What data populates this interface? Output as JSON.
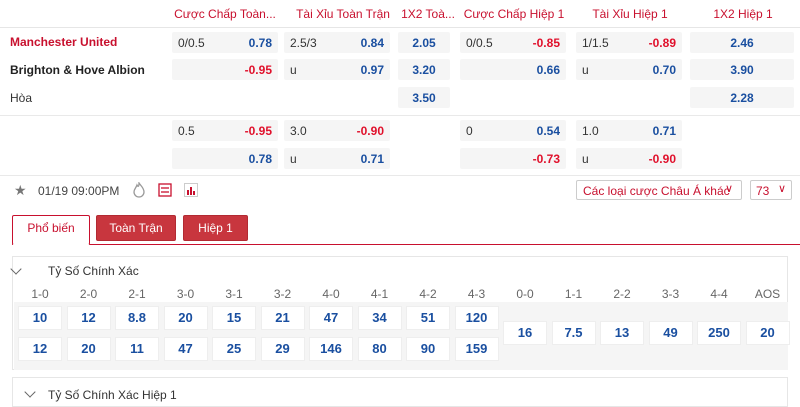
{
  "header": {
    "ah_ft": "Cược Chấp Toàn...",
    "ou_ft": "Tài Xỉu Toàn Trận",
    "x12_ft": "1X2 Toà...",
    "ah_h1": "Cược Chấp Hiệp 1",
    "ou_h1": "Tài Xỉu Hiệp 1",
    "x12_h1": "1X2 Hiệp 1"
  },
  "teams": {
    "home": "Manchester United",
    "away": "Brighton & Hove Albion",
    "draw": "Hòa"
  },
  "row1": {
    "ah_ft_line": "0/0.5",
    "ah_ft_home": "0.78",
    "ah_ft_away": "-0.95",
    "ou_ft_line": "2.5/3",
    "ou_ft_over": "0.84",
    "ou_ft_u": "u",
    "ou_ft_under": "0.97",
    "x12_home": "2.05",
    "x12_away": "3.20",
    "x12_draw": "3.50",
    "ah_h1_line": "0/0.5",
    "ah_h1_home": "-0.85",
    "ah_h1_away": "0.66",
    "ou_h1_line": "1/1.5",
    "ou_h1_over": "-0.89",
    "ou_h1_u": "u",
    "ou_h1_under": "0.70",
    "x12h1_home": "2.46",
    "x12h1_away": "3.90",
    "x12h1_draw": "2.28"
  },
  "row2": {
    "ah_ft_line": "0.5",
    "ah_ft_home": "-0.95",
    "ah_ft_away": "0.78",
    "ou_ft_line": "3.0",
    "ou_ft_over": "-0.90",
    "ou_ft_u": "u",
    "ou_ft_under": "0.71",
    "ah_h1_line": "0",
    "ah_h1_home": "0.54",
    "ah_h1_away": "-0.73",
    "ou_h1_line": "1.0",
    "ou_h1_over": "0.71",
    "ou_h1_u": "u",
    "ou_h1_under": "-0.90"
  },
  "info": {
    "datetime": "01/19 09:00PM",
    "star_icon": "star-icon",
    "bet_types_label": "Các loại cược Châu Á khác",
    "more_count": "73"
  },
  "tabs": [
    "Phổ biến",
    "Toàn Trận",
    "Hiệp 1"
  ],
  "correct_score": {
    "title": "Tỷ Số Chính Xác",
    "headers": [
      "1-0",
      "2-0",
      "2-1",
      "3-0",
      "3-1",
      "3-2",
      "4-0",
      "4-1",
      "4-2",
      "4-3",
      "0-0",
      "1-1",
      "2-2",
      "3-3",
      "4-4",
      "AOS"
    ],
    "home_odds": [
      "10",
      "12",
      "8.8",
      "20",
      "15",
      "21",
      "47",
      "34",
      "51",
      "120"
    ],
    "away_odds": [
      "12",
      "20",
      "11",
      "47",
      "25",
      "29",
      "146",
      "80",
      "90",
      "159"
    ],
    "draw_odds": [
      "16",
      "7.5",
      "13",
      "49",
      "250",
      "20"
    ]
  },
  "correct_score_h1": {
    "title": "Tỷ Số Chính Xác Hiệp 1"
  }
}
